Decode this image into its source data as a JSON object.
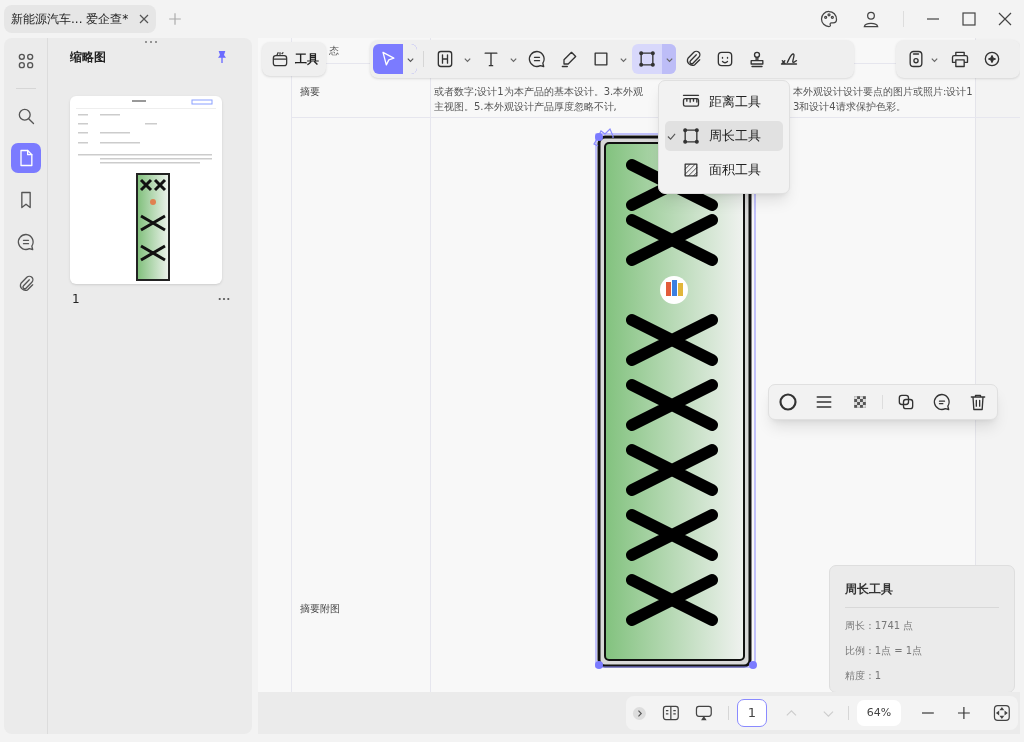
{
  "tab": {
    "title": "新能源汽车... 爱企查*"
  },
  "sidebar": {
    "items": [
      {
        "kind": "grid",
        "selected": false
      },
      {
        "kind": "search",
        "selected": false
      },
      {
        "kind": "page",
        "selected": true
      },
      {
        "kind": "bookmark",
        "selected": false
      },
      {
        "kind": "comment",
        "selected": false
      },
      {
        "kind": "attachment",
        "selected": false
      }
    ]
  },
  "thumbnails": {
    "title": "缩略图",
    "pages": [
      {
        "label": "1",
        "selected": false
      }
    ]
  },
  "document": {
    "cut_label": "态",
    "rows": [
      {
        "label": "摘要",
        "left_lines": [
          "或者数字;设计1为本产品的基本设计。3.本外观",
          "主视图。5.本外观设计产品厚度忽略不计,"
        ],
        "right_lines": [
          "本外观设计设计要点的图片或照片:设计1",
          "3和设计4请求保护色彩。"
        ]
      },
      {
        "label": "摘要附图",
        "left_lines": [],
        "right_lines": []
      }
    ]
  },
  "toolbar": {
    "tools_button": "工具",
    "tools": [
      {
        "kind": "select",
        "selected": true,
        "expanded": false,
        "dropdown": true
      },
      {
        "kind": "heading",
        "selected": false,
        "expanded": false,
        "dropdown": true
      },
      {
        "kind": "text",
        "selected": false,
        "expanded": false,
        "dropdown": true
      },
      {
        "kind": "comment",
        "selected": false,
        "expanded": false,
        "dropdown": false
      },
      {
        "kind": "pen",
        "selected": false,
        "expanded": false,
        "dropdown": false
      },
      {
        "kind": "rect",
        "selected": false,
        "expanded": false,
        "dropdown": true
      },
      {
        "kind": "measure",
        "selected": false,
        "expanded": true,
        "dropdown": true
      },
      {
        "kind": "clip",
        "selected": false,
        "expanded": false,
        "dropdown": false
      },
      {
        "kind": "sticker",
        "selected": false,
        "expanded": false,
        "dropdown": false
      },
      {
        "kind": "stamp",
        "selected": false,
        "expanded": false,
        "dropdown": false
      },
      {
        "kind": "sign",
        "selected": false,
        "expanded": false,
        "dropdown": false
      }
    ],
    "right_tools": [
      {
        "kind": "save",
        "dropdown": true
      },
      {
        "kind": "print",
        "dropdown": false
      },
      {
        "kind": "ai",
        "dropdown": false
      }
    ]
  },
  "measure_menu": {
    "items": [
      {
        "kind": "ruler",
        "label": "距离工具",
        "selected": false
      },
      {
        "kind": "perimeter",
        "label": "周长工具",
        "selected": true
      },
      {
        "kind": "area",
        "label": "面积工具",
        "selected": false
      }
    ]
  },
  "annotation_toolbar": {
    "tools": [
      {
        "kind": "ring"
      },
      {
        "kind": "lines"
      },
      {
        "kind": "checker"
      },
      {
        "kind": "copy"
      },
      {
        "kind": "chat"
      },
      {
        "kind": "trash"
      }
    ]
  },
  "info_panel": {
    "title": "周长工具",
    "lines": [
      "周长 : 1741 点",
      "比例 : 1点 = 1点",
      "精度 : 1"
    ]
  },
  "bottom_bar": {
    "page": "1",
    "zoom": "64%",
    "prev_disabled": true,
    "next_disabled": true
  }
}
